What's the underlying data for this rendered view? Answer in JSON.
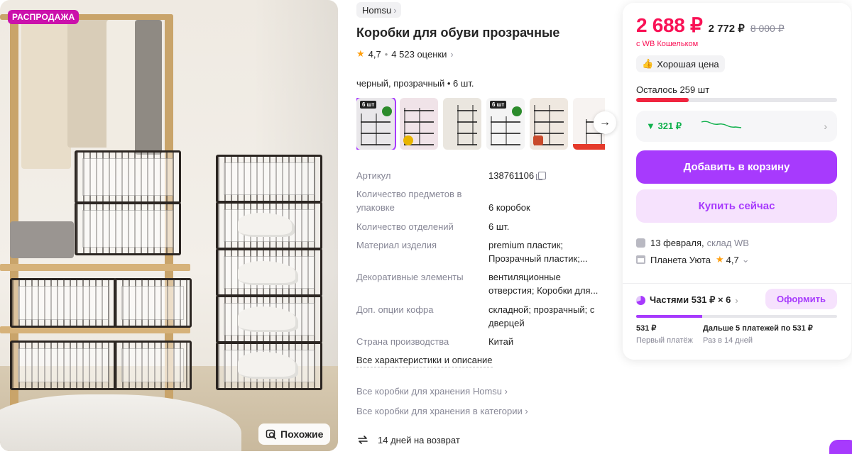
{
  "gallery": {
    "sale_badge": "РАСПРОДАЖА",
    "similar_label": "Похожие"
  },
  "product": {
    "brand": "Homsu",
    "title": "Коробки для обуви прозрачные",
    "rating": "4,7",
    "reviews": "4 523 оценки",
    "variant": "черный, прозрачный • 6 шт.",
    "thumbnail_count": 6,
    "specs": [
      {
        "key": "Артикул",
        "value": "138761106"
      },
      {
        "key": "Количество предметов в упаковке",
        "value": "6 коробок"
      },
      {
        "key": "Количество отделений",
        "value": "6 шт."
      },
      {
        "key": "Материал изделия",
        "value": "premium пластик; Прозрачный пластик;..."
      },
      {
        "key": "Декоративные элементы",
        "value": "вентиляционные отверстия; Коробки для..."
      },
      {
        "key": "Доп. опции кофра",
        "value": "складной; прозрачный; с дверцей"
      },
      {
        "key": "Страна производства",
        "value": "Китай"
      }
    ],
    "all_specs_link": "Все характеристики и описание",
    "link_brand": "Все коробки для хранения Homsu",
    "link_category": "Все коробки для хранения в категории",
    "return_policy": "14 дней на возврат"
  },
  "buy_card": {
    "price": "2 688 ₽",
    "price_no_wallet": "2 772 ₽",
    "price_old": "8 000 ₽",
    "wallet_note": "с WB Кошельком",
    "good_price": "Хорошая цена",
    "stock_left": "Осталось 259 шт",
    "stock_fraction": 0.26,
    "price_drop": "▼ 321 ₽",
    "add_to_cart": "Добавить в корзину",
    "buy_now": "Купить сейчас",
    "delivery_date": "13 февраля,",
    "delivery_warehouse": "склад WB",
    "seller_name": "Планета Уюта",
    "seller_rating": "4,7",
    "installment_label": "Частями 531 ₽ × 6",
    "checkout": "Оформить",
    "installment_fraction": 0.33,
    "first_payment_amount": "531 ₽",
    "first_payment_label": "Первый платёж",
    "next_payments_amount": "Дальше 5 платежей по 531 ₽",
    "next_payments_label": "Раз в 14 дней"
  },
  "colors": {
    "accent": "#a73afd",
    "price": "#f91155",
    "sale": "#cb11ab",
    "drop": "#11b14d"
  }
}
